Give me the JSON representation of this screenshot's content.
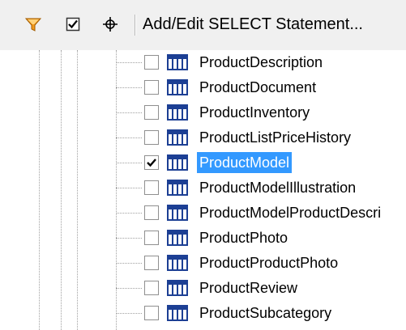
{
  "toolbar": {
    "add_edit_label": "Add/Edit SELECT Statement...",
    "filter_icon": "funnel-filter-icon",
    "check_icon": "checkmark-icon",
    "target_icon": "crosshair-icon"
  },
  "tree": {
    "items": [
      {
        "label": "ProductDescription",
        "checked": false,
        "selected": false
      },
      {
        "label": "ProductDocument",
        "checked": false,
        "selected": false
      },
      {
        "label": "ProductInventory",
        "checked": false,
        "selected": false
      },
      {
        "label": "ProductListPriceHistory",
        "checked": false,
        "selected": false
      },
      {
        "label": "ProductModel",
        "checked": true,
        "selected": true
      },
      {
        "label": "ProductModelIllustration",
        "checked": false,
        "selected": false
      },
      {
        "label": "ProductModelProductDescri",
        "checked": false,
        "selected": false
      },
      {
        "label": "ProductPhoto",
        "checked": false,
        "selected": false
      },
      {
        "label": "ProductProductPhoto",
        "checked": false,
        "selected": false
      },
      {
        "label": "ProductReview",
        "checked": false,
        "selected": false
      },
      {
        "label": "ProductSubcategory",
        "checked": false,
        "selected": false
      }
    ]
  },
  "colors": {
    "selection": "#3399ff",
    "table_icon": "#1c3f94",
    "filter_orange": "#f29a1d"
  }
}
